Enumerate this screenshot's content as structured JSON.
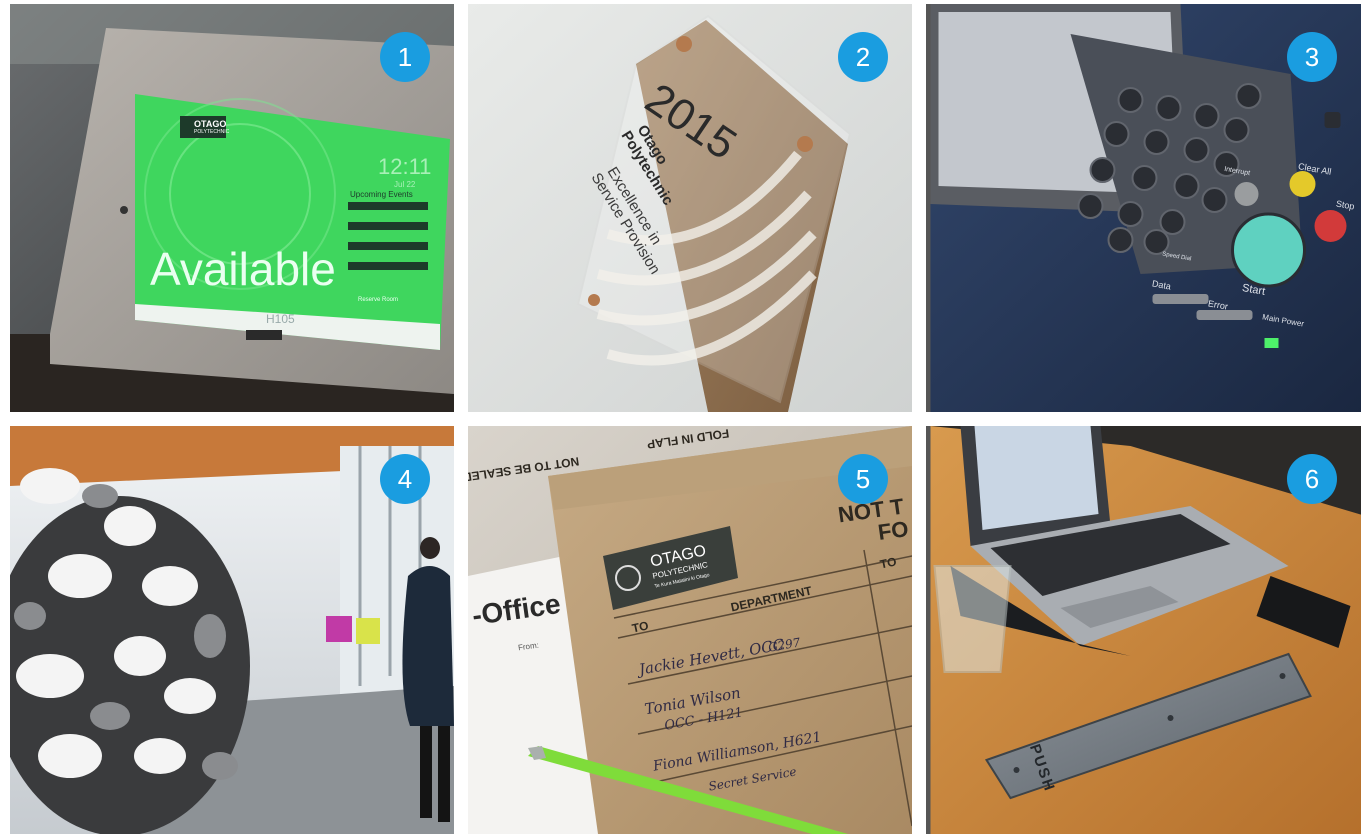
{
  "accent_color": "#1a9de0",
  "tiles": [
    {
      "number": "1",
      "screen": {
        "logo_line1": "OTAGO",
        "logo_line2": "POLYTECHNIC",
        "time": "12:11",
        "date": "Jul 22",
        "status": "Available",
        "upcoming": "Upcoming Events",
        "reserve": "Reserve Room",
        "room": "H105"
      }
    },
    {
      "number": "2",
      "award": {
        "year": "2015",
        "org1": "Otago",
        "org2": "Polytechnic",
        "line1": "Excellence in",
        "line2": "Service Provision"
      }
    },
    {
      "number": "3",
      "panel": {
        "clear_all": "Clear All",
        "stop": "Stop",
        "start": "Start",
        "interrupt": "Interrupt",
        "data": "Data",
        "error": "Error",
        "main_power": "Main Power",
        "speed_dial": "Speed Dial"
      }
    },
    {
      "number": "4"
    },
    {
      "number": "5",
      "envelope": {
        "flap_line1": "NOT TO BE SEALED",
        "flap_line2": "FOLD IN FLAP",
        "heading": "NOT T",
        "heading2": "FO",
        "logo_line1": "OTAGO",
        "logo_line2": "POLYTECHNIC",
        "tagline": "Te Kura Matatini ki Otago",
        "department": "DEPARTMENT",
        "to": "TO",
        "to2": "TO",
        "entry1": "Jackie Hevett, OCC",
        "entry1b": "G297",
        "entry2": "Tonia Wilson",
        "entry2b": "OCC - H121",
        "entry3": "Fiona Williamson, H621",
        "entry4": "Secret Service",
        "form_title": "-Office",
        "from": "From:"
      }
    },
    {
      "number": "6",
      "plate": {
        "label": "PUSH"
      }
    }
  ]
}
